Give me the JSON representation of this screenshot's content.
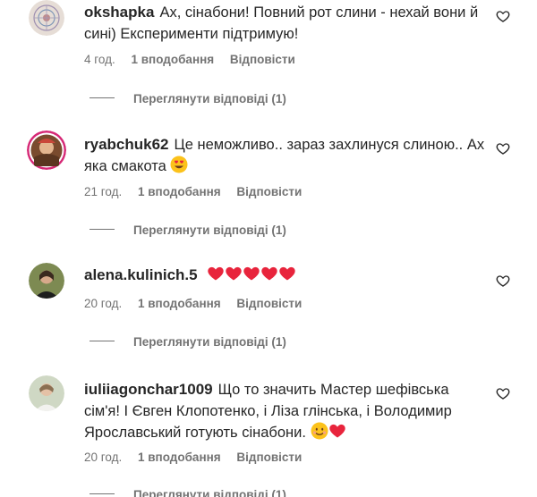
{
  "colors": {
    "text": "#262626",
    "secondary": "#737373",
    "heart_red": "#e8243c"
  },
  "comments": [
    {
      "username": "okshapka",
      "text": "Ах, сінабони! Повний рот слини - нехай вони й сині) Експерименти підтримую!",
      "time": "4 год.",
      "likes": "1 вподобання",
      "reply": "Відповісти",
      "view_replies": "Переглянути відповіді (1)",
      "avatar_icon": "user-avatar-icon"
    },
    {
      "username": "ryabchuk62",
      "text": "Це неможливо.. зараз захлинуся слиною.. Ах яка смакота",
      "emoji": [
        "heart-eyes-emoji"
      ],
      "time": "21 год.",
      "likes": "1 вподобання",
      "reply": "Відповісти",
      "view_replies": "Переглянути відповіді (1)",
      "avatar_icon": "user-avatar-icon"
    },
    {
      "username": "alena.kulinich.5",
      "text": "",
      "emoji": [
        "red-heart-emoji",
        "red-heart-emoji",
        "red-heart-emoji",
        "red-heart-emoji",
        "red-heart-emoji"
      ],
      "time": "20 год.",
      "likes": "1 вподобання",
      "reply": "Відповісти",
      "view_replies": "Переглянути відповіді (1)",
      "avatar_icon": "user-avatar-icon"
    },
    {
      "username": "iuliiagonchar1009",
      "text": "Що то значить Мастер шефівська сім'я! І Євген Клопотенко, і Ліза глінська, і Володимир Ярославський готують сінабони.",
      "emoji": [
        "smiling-face-emoji",
        "red-heart-emoji"
      ],
      "time": "20 год.",
      "likes": "1 вподобання",
      "reply": "Відповісти",
      "view_replies": "Переглянути відповіді (1)",
      "avatar_icon": "user-avatar-icon"
    }
  ],
  "icons": {
    "like": "heart-outline-icon"
  }
}
